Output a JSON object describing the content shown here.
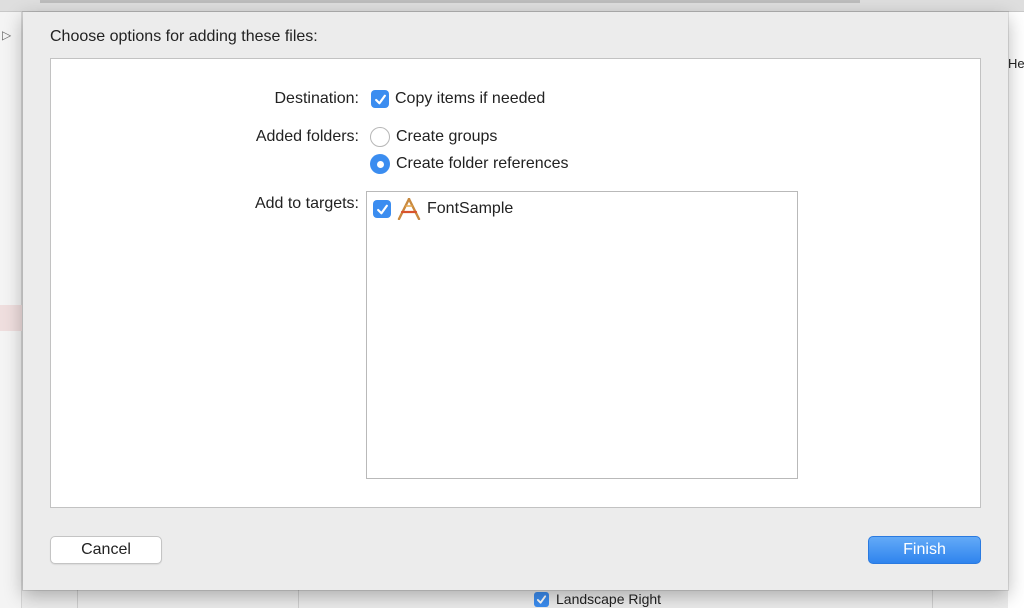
{
  "background": {
    "right_edge_text": "He",
    "bottom_option": {
      "label": "Landscape Right",
      "checked": true
    }
  },
  "dialog": {
    "title": "Choose options for adding these files:",
    "destination": {
      "label": "Destination:",
      "option": {
        "label": "Copy items if needed",
        "checked": true
      }
    },
    "added_folders": {
      "label": "Added folders:",
      "options": [
        {
          "label": "Create groups",
          "selected": false
        },
        {
          "label": "Create folder references",
          "selected": true
        }
      ]
    },
    "targets": {
      "label": "Add to targets:",
      "items": [
        {
          "name": "FontSample",
          "checked": true,
          "icon": "xcode-app-icon"
        }
      ]
    },
    "buttons": {
      "cancel": "Cancel",
      "finish": "Finish"
    }
  },
  "colors": {
    "accent": "#3b8df0",
    "finish_button": "#2f84ee",
    "sheet_background": "#ececec"
  }
}
